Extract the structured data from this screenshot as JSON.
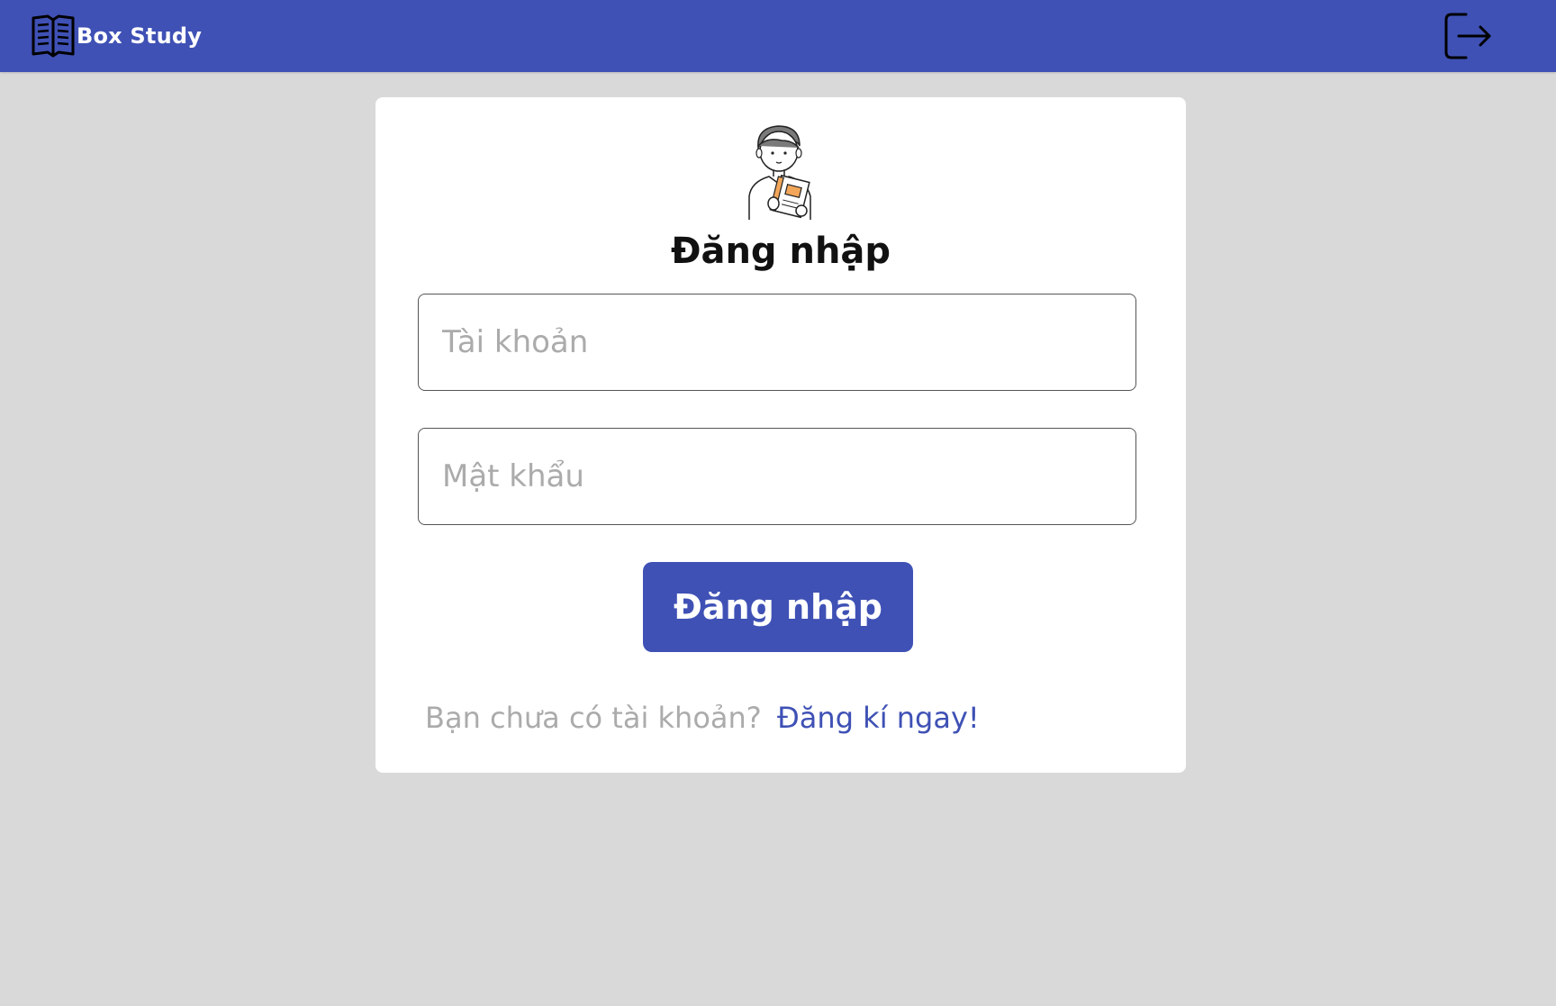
{
  "header": {
    "brand_name": "Box Study",
    "brand_icon": "open-book-icon",
    "logout_icon": "logout-icon",
    "background_color": "#3f51b5"
  },
  "login": {
    "title": "Đăng nhập",
    "username_placeholder": "Tài khoản",
    "password_placeholder": "Mật khẩu",
    "submit_label": "Đăng nhập",
    "signup_prompt": "Bạn chưa có tài khoản?",
    "signup_link": "Đăng kí ngay!",
    "accent_color": "#3f51b5"
  }
}
